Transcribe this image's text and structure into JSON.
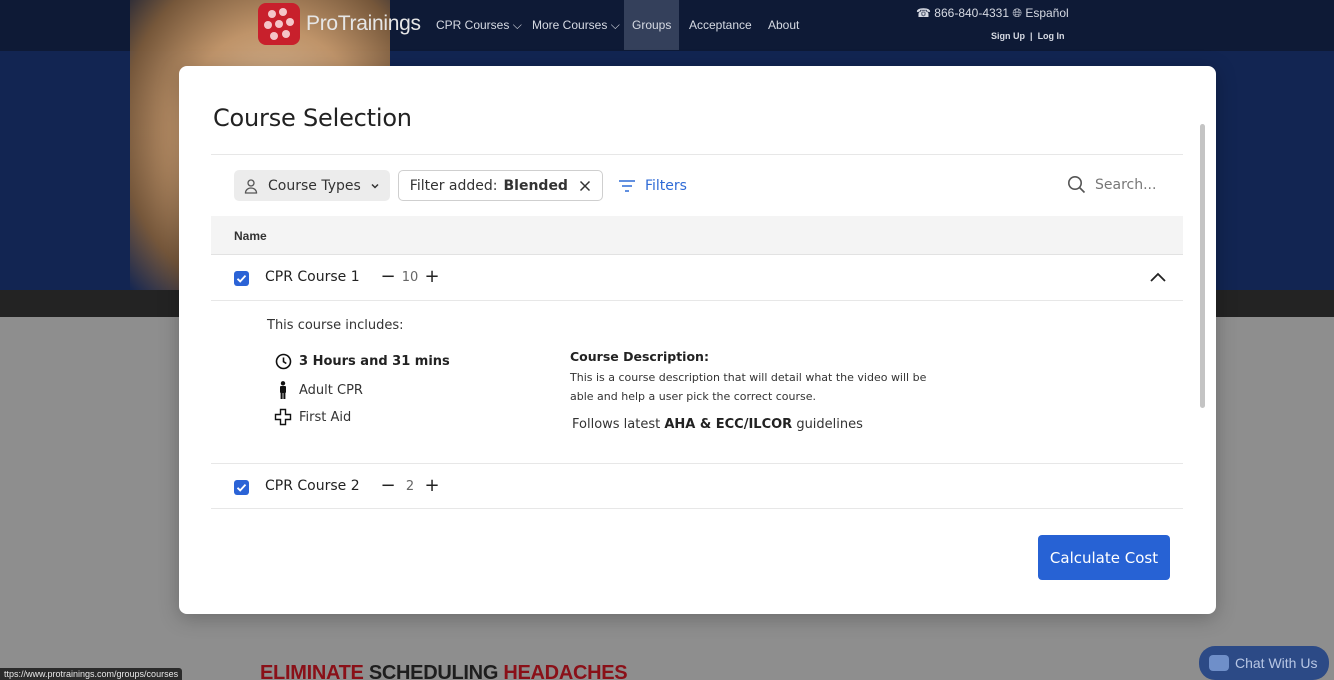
{
  "site": {
    "logo_text": "ProTrainings",
    "nav": [
      {
        "label": "CPR Courses ⌵"
      },
      {
        "label": "More Courses ⌵"
      },
      {
        "label": "Groups"
      },
      {
        "label": "Acceptance"
      },
      {
        "label": "About"
      }
    ],
    "phone": "866-840-4331",
    "language": "Español",
    "sign_up": "Sign Up",
    "separator": "|",
    "log_in": "Log In",
    "status_url": "ttps://www.protrainings.com/groups/courses",
    "headline_red1": "ELIMINATE",
    "headline_dark": " SCHEDULING ",
    "headline_red2": "HEADACHES",
    "chat_label": "Chat With Us"
  },
  "modal": {
    "title": "Course Selection",
    "course_types_label": "Course Types",
    "filter_prefix": "Filter added:",
    "filter_value": "Blended",
    "filters_label": "Filters",
    "search_placeholder": "Search...",
    "column_name": "Name",
    "courses": [
      {
        "name": "CPR Course 1",
        "checked": true,
        "quantity": "10",
        "expanded": true,
        "includes_label": "This course includes:",
        "duration": "3 Hours and 31 mins",
        "feature_1": "Adult CPR",
        "feature_2": "First Aid",
        "desc_title": "Course Description:",
        "desc_body": "This is a course description that will detail what the video will be able and help a user pick the correct course.",
        "guidelines_prefix": "Follows latest ",
        "guidelines_bold": "AHA & ECC/ILCOR",
        "guidelines_suffix": " guidelines"
      },
      {
        "name": "CPR Course 2",
        "checked": true,
        "quantity": "2",
        "expanded": false
      }
    ],
    "minus": "−",
    "plus": "+",
    "calculate_label": "Calculate Cost"
  },
  "colors": {
    "accent": "#2762d4",
    "nav_bg": "#0e1a36",
    "hero_bg": "#122552"
  }
}
